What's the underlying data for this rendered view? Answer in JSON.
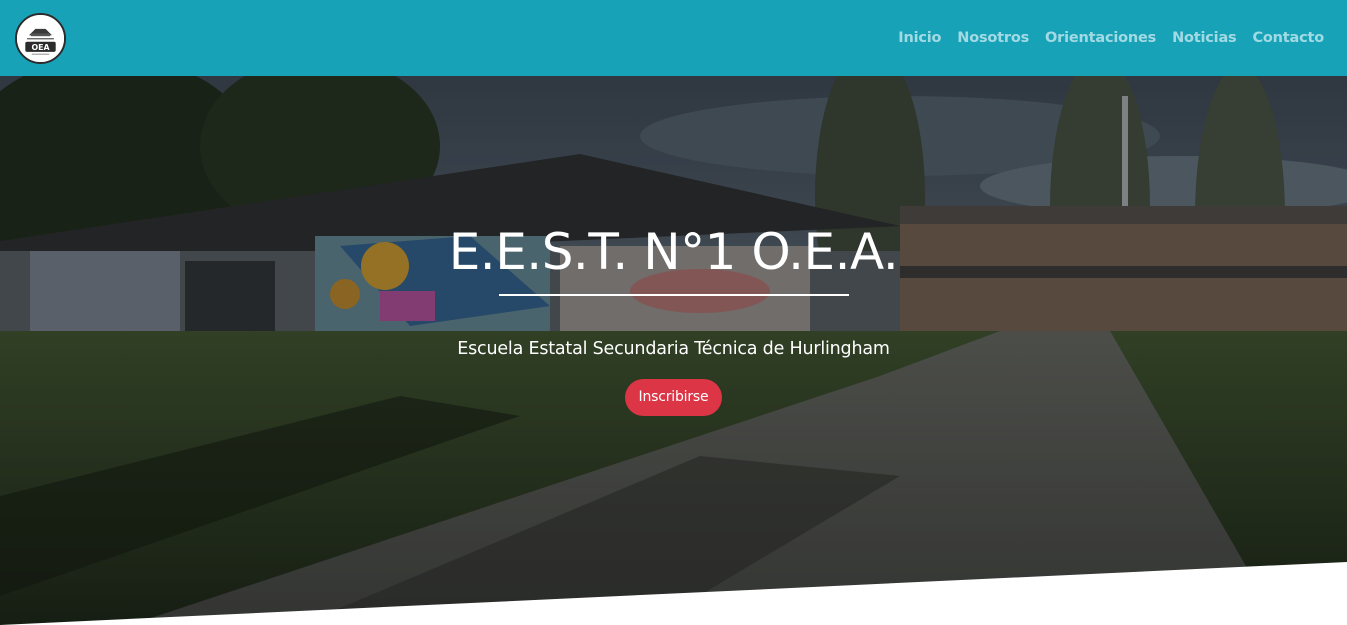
{
  "logo": {
    "text": "OEA",
    "icon": "school-logo-icon"
  },
  "nav": {
    "items": [
      {
        "label": "Inicio"
      },
      {
        "label": "Nosotros"
      },
      {
        "label": "Orientaciones"
      },
      {
        "label": "Noticias"
      },
      {
        "label": "Contacto"
      }
    ]
  },
  "hero": {
    "title": "E.E.S.T. N°1 O.E.A.",
    "subtitle": "Escuela Estatal Secundaria Técnica de Hurlingham",
    "button_label": "Inscribirse"
  },
  "colors": {
    "navbar": "#17a2b8",
    "button": "#dc3545",
    "text": "#ffffff"
  }
}
